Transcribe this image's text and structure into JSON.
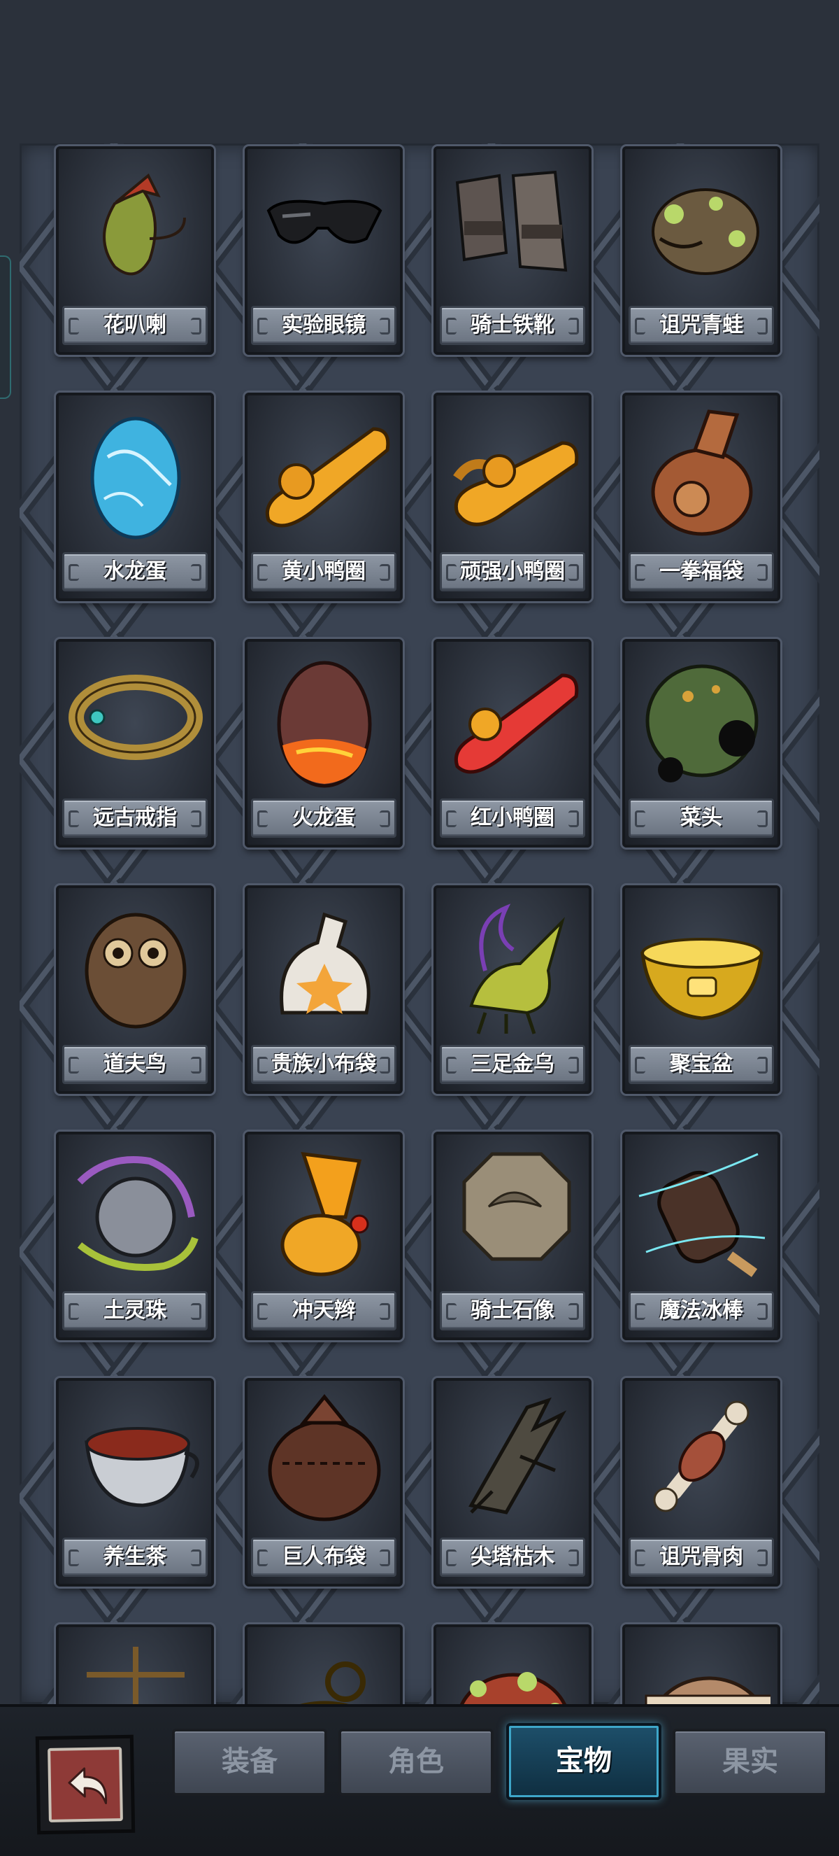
{
  "items": [
    {
      "name": "花叭喇",
      "icon": "pitcher-plant-icon"
    },
    {
      "name": "实验眼镜",
      "icon": "sunglasses-icon"
    },
    {
      "name": "骑士铁靴",
      "icon": "iron-boots-icon"
    },
    {
      "name": "诅咒青蛙",
      "icon": "cursed-frog-icon"
    },
    {
      "name": "水龙蛋",
      "icon": "water-dragon-egg-icon"
    },
    {
      "name": "黄小鸭圈",
      "icon": "yellow-duck-ring-icon"
    },
    {
      "name": "顽强小鸭圈",
      "icon": "tough-duck-ring-icon"
    },
    {
      "name": "一拳福袋",
      "icon": "punch-bag-icon"
    },
    {
      "name": "远古戒指",
      "icon": "ancient-ring-icon"
    },
    {
      "name": "火龙蛋",
      "icon": "fire-dragon-egg-icon"
    },
    {
      "name": "红小鸭圈",
      "icon": "red-duck-ring-icon"
    },
    {
      "name": "菜头",
      "icon": "cabbage-head-icon"
    },
    {
      "name": "道夫鸟",
      "icon": "owl-bird-icon"
    },
    {
      "name": "贵族小布袋",
      "icon": "noble-pouch-icon"
    },
    {
      "name": "三足金乌",
      "icon": "golden-crow-icon"
    },
    {
      "name": "聚宝盆",
      "icon": "treasure-bowl-icon"
    },
    {
      "name": "土灵珠",
      "icon": "earth-orb-icon"
    },
    {
      "name": "冲天辫",
      "icon": "topknot-icon"
    },
    {
      "name": "骑士石像",
      "icon": "stone-statue-icon"
    },
    {
      "name": "魔法冰棒",
      "icon": "magic-popsicle-icon"
    },
    {
      "name": "养生茶",
      "icon": "health-tea-icon"
    },
    {
      "name": "巨人布袋",
      "icon": "giant-sack-icon"
    },
    {
      "name": "尖塔枯木",
      "icon": "dead-wood-icon"
    },
    {
      "name": "诅咒骨肉",
      "icon": "cursed-bone-meat-icon"
    },
    {
      "name": "",
      "icon": "scales-icon"
    },
    {
      "name": "",
      "icon": "golden-lamp-icon"
    },
    {
      "name": "",
      "icon": "red-frog-icon"
    },
    {
      "name": "",
      "icon": "bandaged-face-icon"
    }
  ],
  "tabs": [
    {
      "label": "装备",
      "active": false
    },
    {
      "label": "角色",
      "active": false
    },
    {
      "label": "宝物",
      "active": true
    },
    {
      "label": "果实",
      "active": false
    }
  ],
  "colors": {
    "background": "#2b313b",
    "panel": "#3a4352",
    "label_plate": "#7f8895",
    "active_tab": "#1d4f6a",
    "back_button": "#8e3a37"
  }
}
